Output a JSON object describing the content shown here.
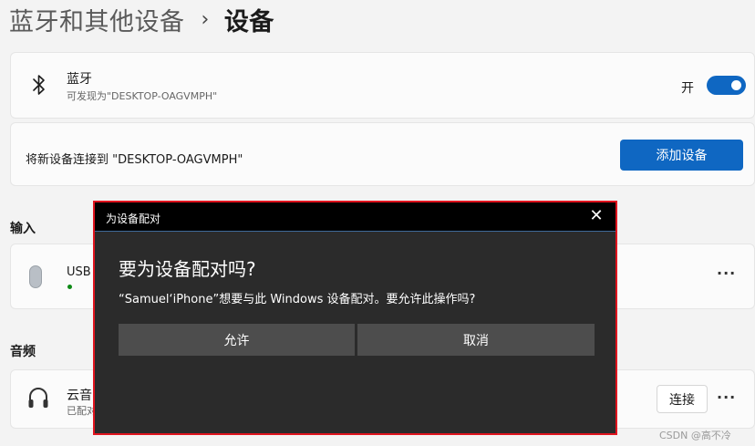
{
  "breadcrumb": {
    "parent": "蓝牙和其他设备",
    "separator": "›",
    "current": "设备"
  },
  "bluetooth": {
    "icon": "bluetooth-icon",
    "title": "蓝牙",
    "subtitle": "可发现为\"DESKTOP-OAGVMPH\"",
    "toggle_label": "开",
    "toggle_on": true
  },
  "add_device": {
    "label": "将新设备连接到 \"DESKTOP-OAGVMPH\"",
    "button": "添加设备"
  },
  "input_section": {
    "title": "输入",
    "device": {
      "icon": "mouse-icon",
      "name": "USB",
      "status_color": "#0e8a16",
      "more": "···"
    }
  },
  "audio_section": {
    "title": "音频",
    "device": {
      "icon": "headphones-icon",
      "name": "云音",
      "status": "已配对",
      "connect_button": "连接",
      "more": "···"
    }
  },
  "dialog": {
    "title": "为设备配对",
    "close": "✕",
    "heading": "要为设备配对吗?",
    "message": "“Samuel‘iPhone”想要与此 Windows 设备配对。要允许此操作吗?",
    "allow_button": "允许",
    "cancel_button": "取消",
    "highlight_color": "#e0141e"
  },
  "watermark": "CSDN @高不冷",
  "colors": {
    "accent": "#0f67c2",
    "background": "#f3f3f3",
    "dialog_bg": "#2b2b2b"
  }
}
